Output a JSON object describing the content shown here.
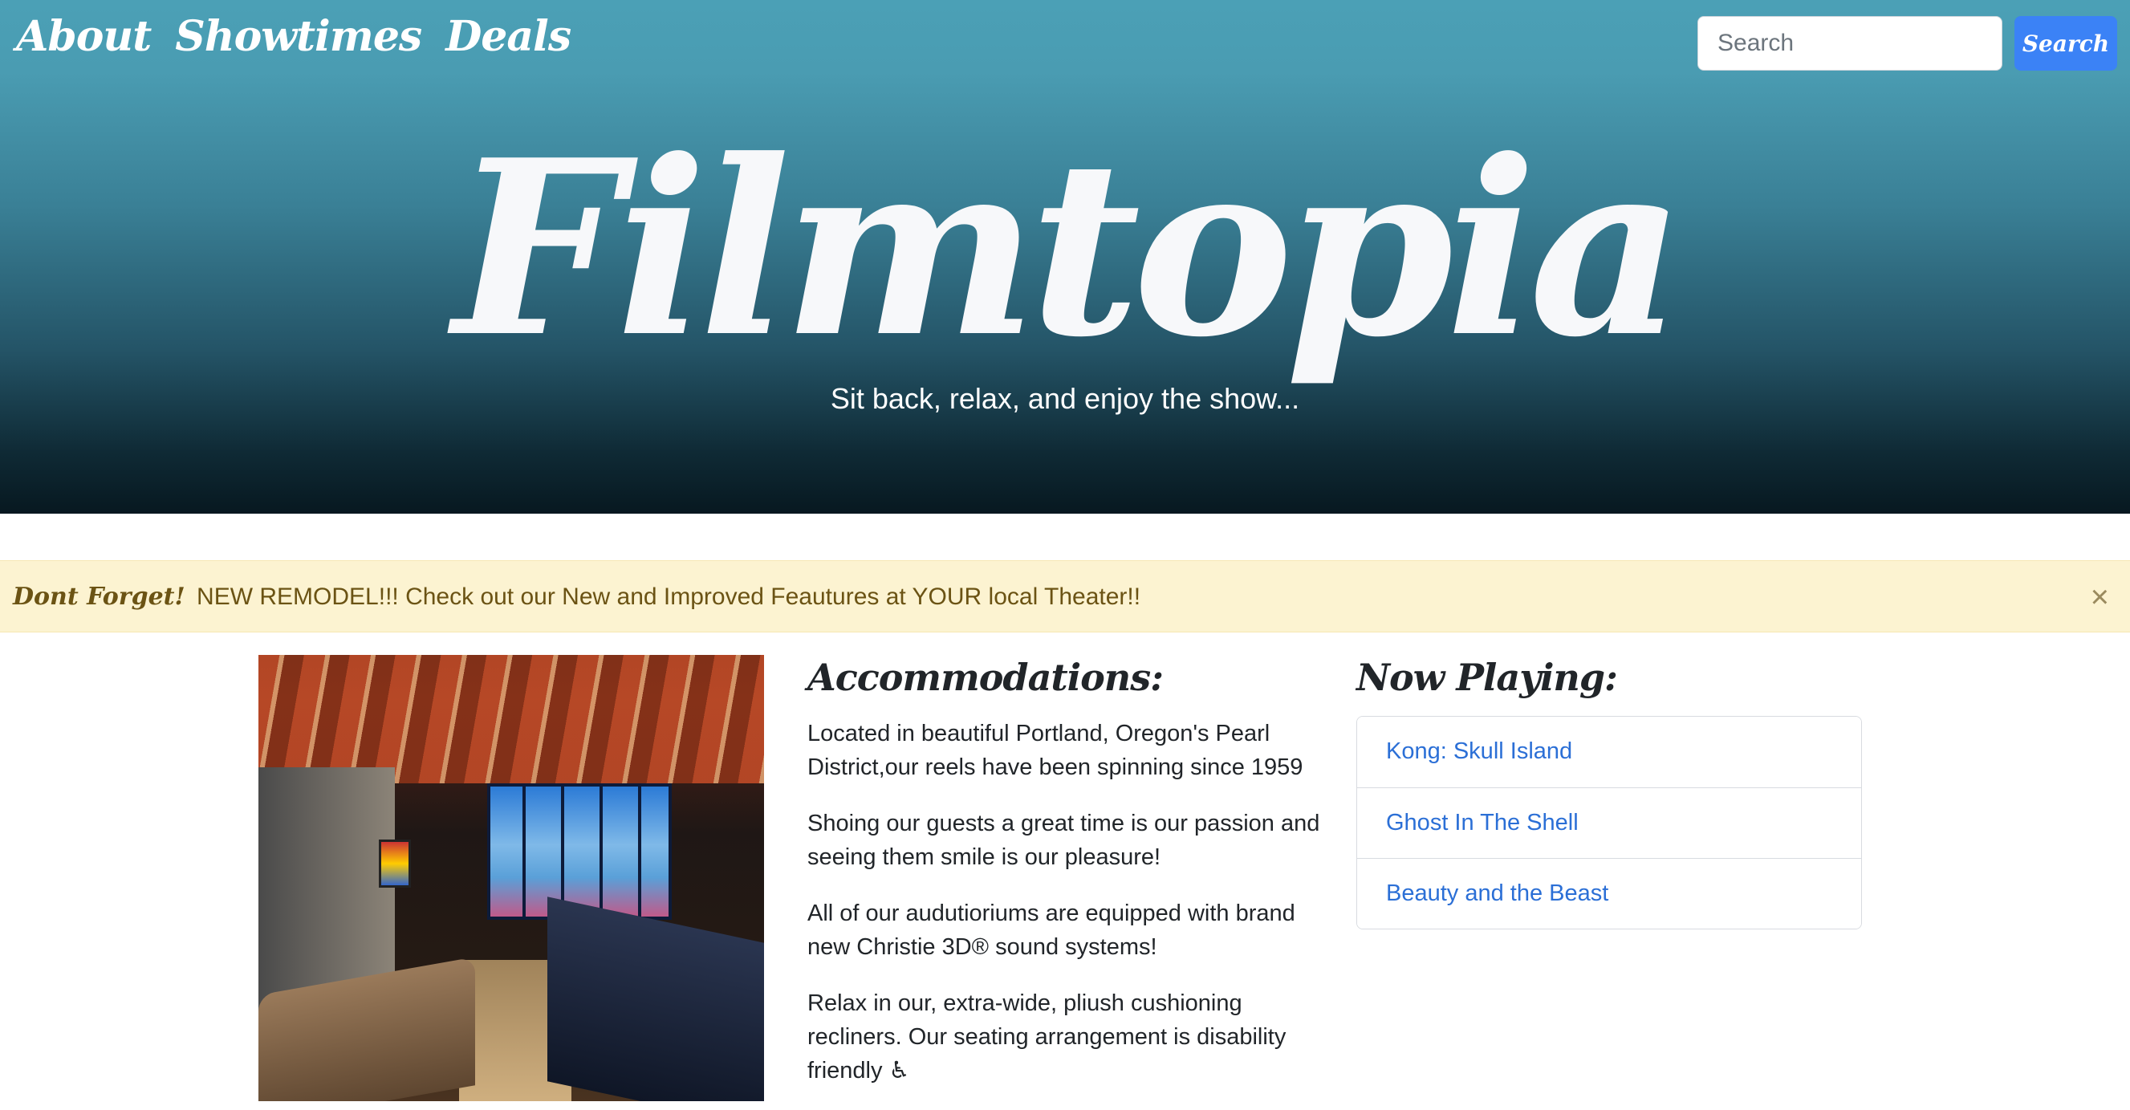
{
  "nav": {
    "items": [
      {
        "label": "About"
      },
      {
        "label": "Showtimes"
      },
      {
        "label": "Deals"
      }
    ]
  },
  "search": {
    "placeholder": "Search",
    "button_label": "Search"
  },
  "hero": {
    "brand": "Filmtopia",
    "tagline": "Sit back, relax, and enjoy the show..."
  },
  "alert": {
    "strong": "Dont Forget!",
    "message": "NEW REMODEL!!! Check out our New and Improved Feautures at YOUR local Theater!!",
    "close_symbol": "×"
  },
  "accommodations": {
    "heading": "Accommodations:",
    "paragraphs": [
      "Located in beautiful Portland, Oregon's Pearl District,our reels have been spinning since 1959",
      "Shoing our guests a great time is our passion and seeing them smile is our pleasure!",
      "All of our audutioriums are equipped with brand new Christie 3D® sound systems!",
      "Relax in our, extra-wide, pliush cushioning recliners. Our seating arrangement is disability friendly ♿"
    ]
  },
  "now_playing": {
    "heading": "Now Playing:",
    "movies": [
      {
        "title": "Kong: Skull Island"
      },
      {
        "title": "Ghost In The Shell"
      },
      {
        "title": "Beauty and the Beast"
      }
    ]
  },
  "colors": {
    "search_button": "#3b82f6",
    "alert_bg": "#fcf3d1",
    "link": "#2b6fd6"
  },
  "icons": {
    "alert_close": "close-icon",
    "accessibility": "wheelchair-icon"
  }
}
